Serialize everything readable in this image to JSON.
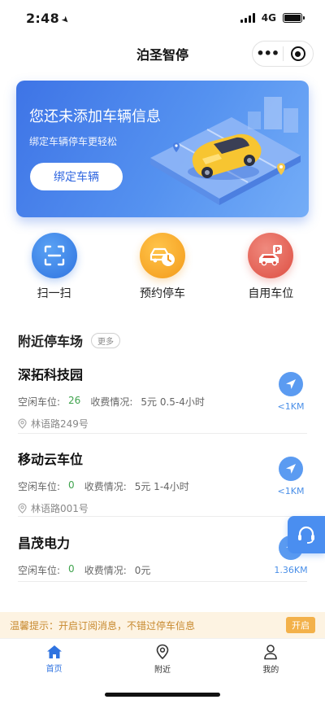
{
  "status_bar": {
    "time": "2:48",
    "network": "4G",
    "battery_level": 1.0
  },
  "nav": {
    "title": "泊圣智停",
    "more_icon": "more-dots-icon",
    "close_icon": "target-circle-icon"
  },
  "banner": {
    "title": "您还未添加车辆信息",
    "subtitle": "绑定车辆停车更轻松",
    "button_label": "绑定车辆"
  },
  "actions": [
    {
      "label": "扫一扫",
      "icon": "scan-icon",
      "color": "#2f73e0"
    },
    {
      "label": "预约停车",
      "icon": "car-clock-icon",
      "color": "#f39a1a"
    },
    {
      "label": "自用车位",
      "icon": "car-parking-icon",
      "color": "#dd4e42"
    }
  ],
  "nearby": {
    "title": "附近停车场",
    "more_label": "更多",
    "free_label": "空闲车位:",
    "fee_label": "收费情况:",
    "lots": [
      {
        "name": "深拓科技园",
        "free": "26",
        "fee": "5元 0.5-4小时",
        "address": "林语路249号",
        "distance": "<1KM"
      },
      {
        "name": "移动云车位",
        "free": "0",
        "fee": "5元 1-4小时",
        "address": "林语路001号",
        "distance": "<1KM"
      },
      {
        "name": "昌茂电力",
        "free": "0",
        "fee": "0元",
        "address": "",
        "distance": "1.36KM"
      }
    ]
  },
  "tip": {
    "text": "温馨提示：开启订阅消息，不错过停车信息",
    "button_label": "开启"
  },
  "tabbar": [
    {
      "label": "首页",
      "icon": "home-icon",
      "active": true
    },
    {
      "label": "附近",
      "icon": "location-pin-icon",
      "active": false
    },
    {
      "label": "我的",
      "icon": "user-icon",
      "active": false
    }
  ],
  "colors": {
    "primary": "#2f73e0",
    "free_green": "#3fa34d",
    "tip_bg": "#fdf3e2",
    "tip_text": "#c88a2f"
  }
}
